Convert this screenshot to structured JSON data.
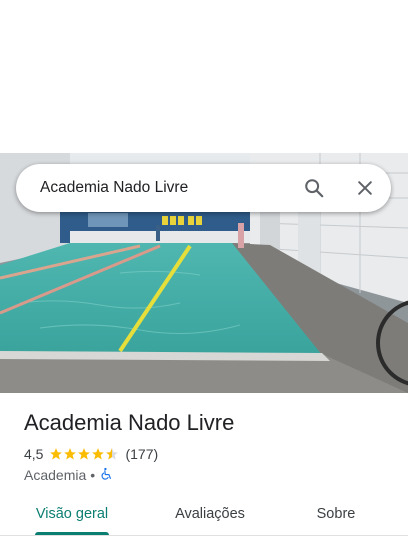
{
  "search": {
    "value": "Academia Nado Livre",
    "search_icon": "search-icon",
    "close_icon": "close-icon"
  },
  "place": {
    "name": "Academia Nado Livre",
    "rating": "4,5",
    "rating_stars": 4.5,
    "review_count": "(177)",
    "category": "Academia",
    "separator": "•",
    "accessibility_icon": "wheelchair-icon"
  },
  "tabs": [
    {
      "label": "Visão geral",
      "active": true
    },
    {
      "label": "Avaliações",
      "active": false
    },
    {
      "label": "Sobre",
      "active": false
    }
  ],
  "colors": {
    "accent": "#0b7e72",
    "star": "#fbbc04",
    "accessibility": "#1a73e8"
  }
}
